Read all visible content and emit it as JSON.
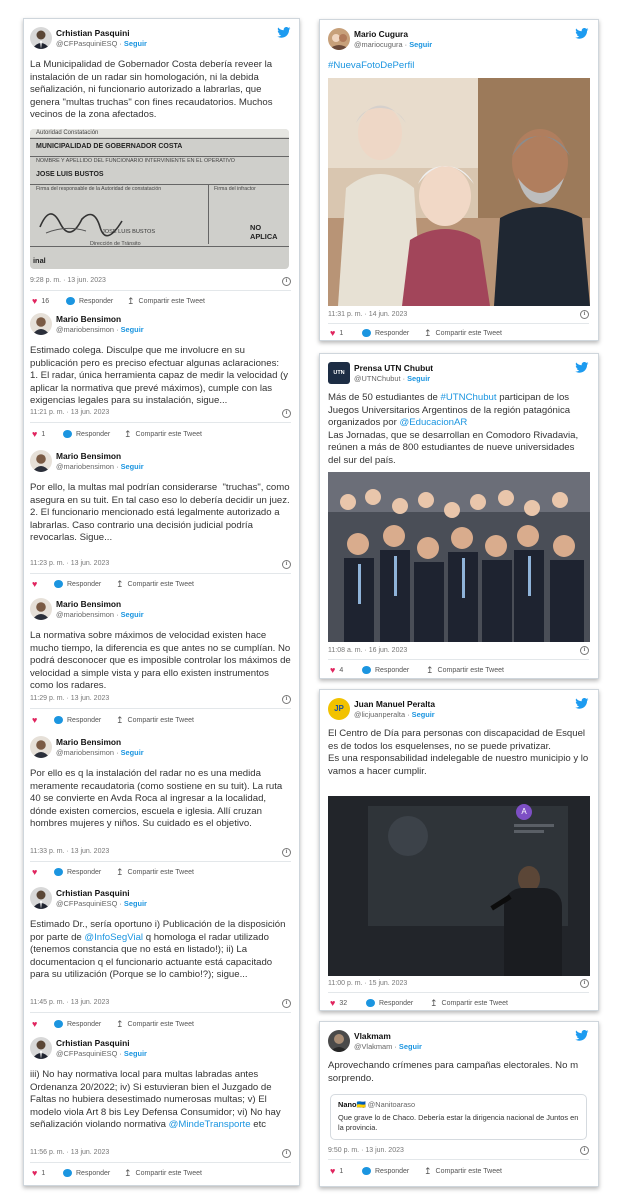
{
  "common": {
    "follow": "Seguir",
    "reply": "Responder",
    "share": "Compartir este Tweet",
    "dot": "·"
  },
  "thread": [
    {
      "name": "Crhistian Pasquini",
      "handle": "@CFPasquiniESQ",
      "text": "La Municipalidad de Gobernador Costa debería reveer la instalación de un radar sin homologación, ni la debida señalización, ni funcionario autorizado a labrarlas, que genera \"multas truchas\" con fines recaudatorios. Muchos vecinos de la zona afectados.",
      "time": "9:28 p. m. · 13 jun. 2023",
      "likes": "16",
      "doc": {
        "l1": "Autoridad Constatación",
        "l2": "MUNICIPALIDAD DE GOBERNADOR COSTA",
        "l3": "NOMBRE Y APELLIDO DEL FUNCIONARIO INTERVINIENTE EN EL OPERATIVO",
        "l4": "JOSE LUIS BUSTOS",
        "l5": "Firma del responsable de la Autoridad de constatación",
        "l6": "Firma del infractor",
        "l7": "JOSE LUIS BUSTOS",
        "l8": "NO APLICA",
        "l9": "Dirección de Tránsito",
        "l10": "inal"
      }
    },
    {
      "name": "Mario Bensimon",
      "handle": "@mariobensimon",
      "text": "Estimado colega. Disculpe que me involucre en su publicación pero es preciso efectuar algunas aclaraciones:\n1. El radar, única herramienta capaz de medir la velocidad (y aplicar la normativa que prevé máximos), cumple con las exigencias legales para su instalación, sigue...",
      "time": "11:21 p. m. · 13 jun. 2023",
      "likes": "1"
    },
    {
      "name": "Mario Bensimon",
      "handle": "@mariobensimon",
      "text": "Por ello, la multas mal podrían considerarse  \"truchas\", como asegura en su tuit. En tal caso eso lo debería decidir un juez.\n2. El funcionario mencionado está legalmente autorizado a labrarlas. Caso contrario una decisión judicial podría revocarlas. Sigue...",
      "time": "11:23 p. m. · 13 jun. 2023",
      "likes": ""
    },
    {
      "name": "Mario Bensimon",
      "handle": "@mariobensimon",
      "text": "La normativa sobre máximos de velocidad existen hace mucho tiempo, la diferencia es que antes no se cumplían. No podrá desconocer que es imposible controlar los máximos de velocidad a simple vista y para ello existen instrumentos como los radares.",
      "time": "11:29 p. m. · 13 jun. 2023",
      "likes": ""
    },
    {
      "name": "Mario Bensimon",
      "handle": "@mariobensimon",
      "text": "Por ello es q la instalación del radar no es una medida meramente recaudatoria (como sostiene en su tuit). La ruta 40 se convierte en Avda Roca al ingresar a la localidad, dónde existen comercios, escuela e iglesia. Allí cruzan hombres mujeres y niños. Su cuidado es el objetivo.",
      "time": "11:33 p. m. · 13 jun. 2023",
      "likes": ""
    },
    {
      "name": "Crhistian Pasquini",
      "handle": "@CFPasquiniESQ",
      "text_a": "Estimado Dr., sería oportuno i) Publicación de la disposición por parte de ",
      "link": "@InfoSegVial",
      "text_b": " q homologa el radar utilizado (tenemos constancia que no está en listado!); ii) La documentacion q el funcionario actuante está capacitado para su utilización (Porque se lo cambio!?); sigue...",
      "time": "11:45 p. m. · 13 jun. 2023",
      "likes": ""
    },
    {
      "name": "Crhistian Pasquini",
      "handle": "@CFPasquiniESQ",
      "text_a": "iii) No hay normativa local para multas labradas antes Ordenanza 20/2022; iv) Si estuvieran bien el Juzgado de Faltas no hubiera desestimado numerosas multas; v) El modelo viola Art 8 bis Ley Defensa Consumidor; vi) No hay señalización violando normativa ",
      "link": "@MindeTransporte",
      "text_b": " etc",
      "time": "11:56 p. m. · 13 jun. 2023",
      "likes": "1"
    }
  ],
  "right": [
    {
      "name": "Mario Cugura",
      "handle": "@mariocugura",
      "hashtag": "#NuevaFotoDePerfil",
      "time": "11:31 p. m. · 14 jun. 2023",
      "likes": "1"
    },
    {
      "name": "Prensa UTN Chubut",
      "handle": "@UTNChubut",
      "avatar_text": "UTN",
      "t1": "Más de 50 estudiantes de ",
      "l1": "#UTNChubut",
      "t2": " participan de los Juegos Universitarios Argentinos de la región patagónica organizados por ",
      "l2": "@EducacionAR",
      "t3": "\nLas Jornadas, que se desarrollan en Comodoro Rivadavia, reúnen a más de 800 estudiantes de nueve universidades del sur del país.",
      "time": "11:08 a. m. · 16 jun. 2023",
      "likes": "4"
    },
    {
      "name": "Juan Manuel Peralta",
      "handle": "@licjuanperalta",
      "avatar_text": "JP",
      "text": "El Centro de Día para personas con discapacidad de Esquel es de todos los esquelenses, no se puede privatizar.\nEs una responsabilidad indelegable de nuestro municipio y lo vamos a hacer cumplir.",
      "time": "11:00 p. m. · 15 jun. 2023",
      "likes": "32",
      "screen_avatar": "A"
    },
    {
      "name": "Vlakmam",
      "handle": "@Vlakmam",
      "text": "Aprovechando crímenes para campañas electorales. No m sorprendo.",
      "quote_name": "Nano",
      "quote_flag": "🇺🇦",
      "quote_handle": "@Nanitoaraso",
      "quote_text": "Que grave lo de Chaco. Debería estar la dirigencia nacional de Juntos en la provincia.",
      "time": "9:50 p. m. · 13 jun. 2023",
      "likes": "1"
    }
  ],
  "colors": {
    "link": "#1b95e0",
    "heart": "#e0245e",
    "bird": "#1d9bf0"
  }
}
